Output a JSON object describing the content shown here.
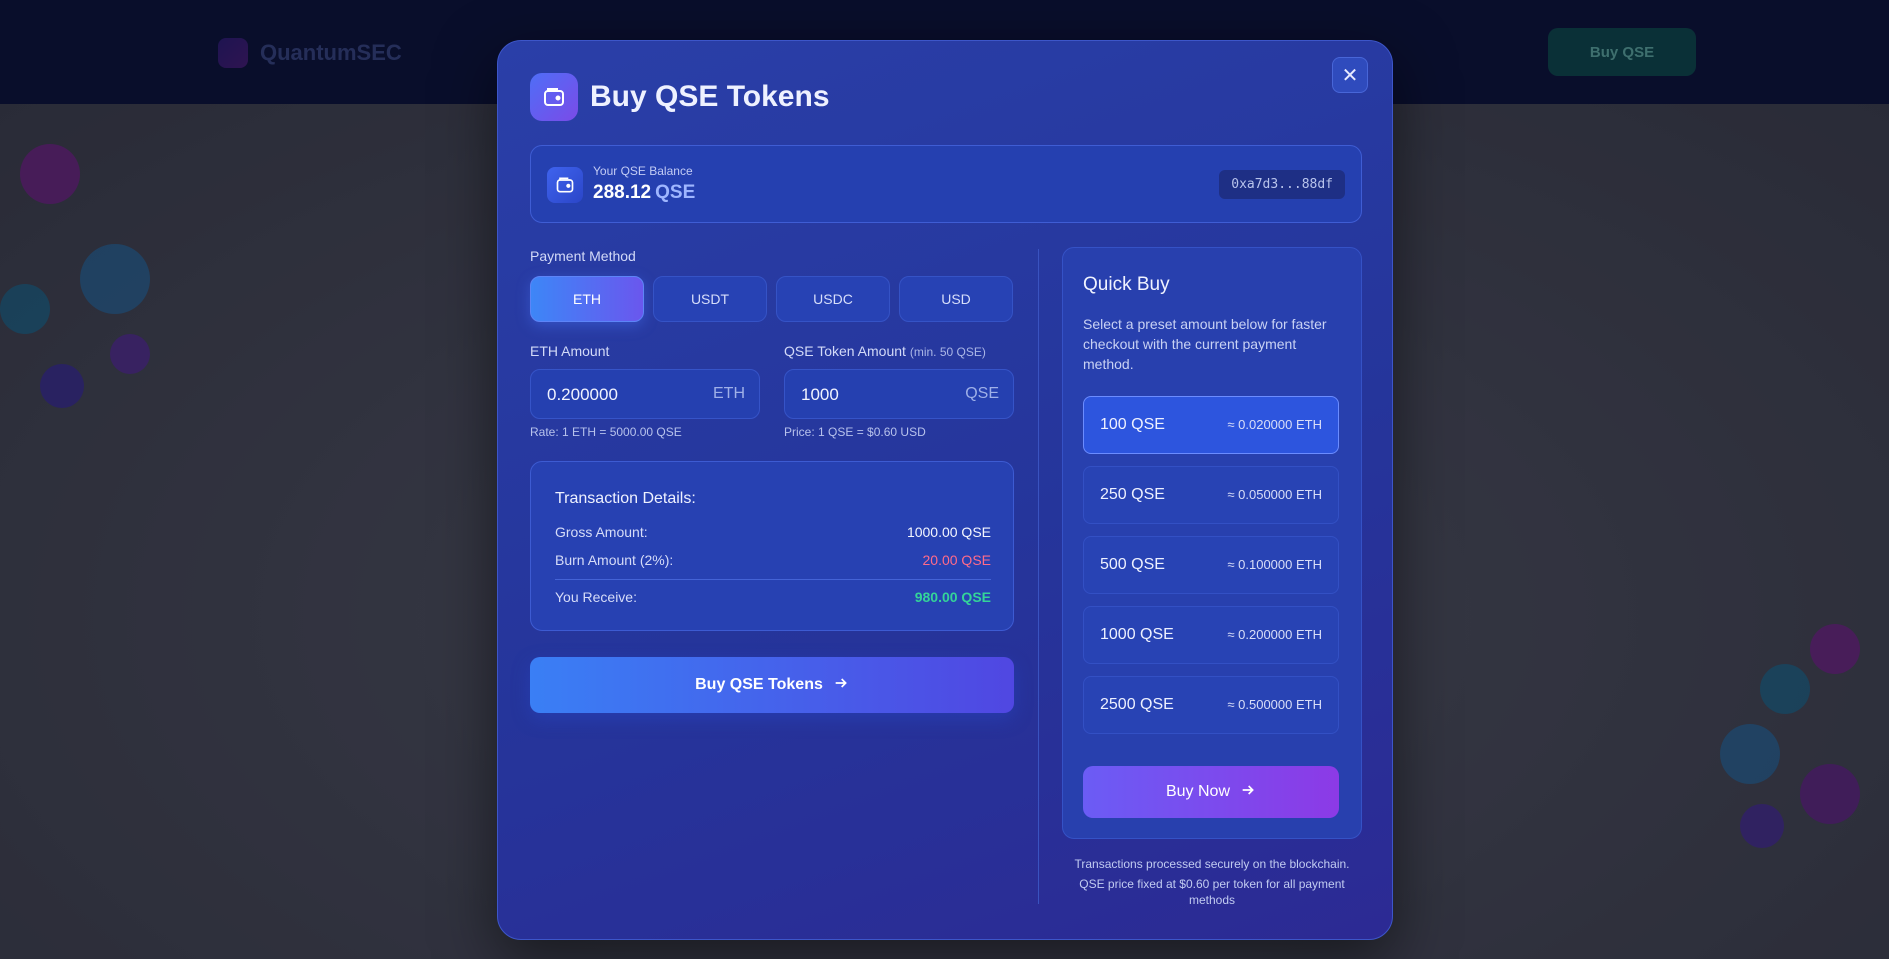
{
  "background": {
    "brand": "QuantumSEC",
    "header_button": "Buy QSE"
  },
  "modal": {
    "title": "Buy QSE Tokens",
    "close_icon": "close-icon",
    "balance": {
      "label": "Your QSE Balance",
      "value": "288.12",
      "unit": "QSE",
      "address": "0xa7d3...88df"
    },
    "payment": {
      "label": "Payment Method",
      "methods": [
        "ETH",
        "USDT",
        "USDC",
        "USD"
      ],
      "selected": "ETH"
    },
    "eth_amount": {
      "label": "ETH Amount",
      "value": "0.200000",
      "unit": "ETH",
      "hint": "Rate: 1 ETH = 5000.00 QSE"
    },
    "qse_amount": {
      "label": "QSE Token Amount",
      "min_note": "(min. 50 QSE)",
      "value": "1000",
      "unit": "QSE",
      "hint": "Price: 1 QSE = $0.60 USD"
    },
    "transaction": {
      "title": "Transaction Details:",
      "gross_label": "Gross Amount:",
      "gross_value": "1000.00 QSE",
      "burn_label": "Burn Amount (2%):",
      "burn_value": "20.00 QSE",
      "receive_label": "You Receive:",
      "receive_value": "980.00 QSE"
    },
    "buy_button": "Buy QSE Tokens",
    "quick_buy": {
      "title": "Quick Buy",
      "description": "Select a preset amount below for faster checkout with the current payment method.",
      "presets": [
        {
          "qse": "100 QSE",
          "eth": "≈ 0.020000 ETH"
        },
        {
          "qse": "250 QSE",
          "eth": "≈ 0.050000 ETH"
        },
        {
          "qse": "500 QSE",
          "eth": "≈ 0.100000 ETH"
        },
        {
          "qse": "1000 QSE",
          "eth": "≈ 0.200000 ETH"
        },
        {
          "qse": "2500 QSE",
          "eth": "≈ 0.500000 ETH"
        }
      ],
      "buy_now": "Buy Now"
    },
    "footnote_1": "Transactions processed securely on the blockchain.",
    "footnote_2": "QSE price fixed at $0.60 per token for all payment methods"
  },
  "colors": {
    "burn": "#ff6b8a",
    "receive": "#34d399",
    "accent": "#3d86f7"
  }
}
